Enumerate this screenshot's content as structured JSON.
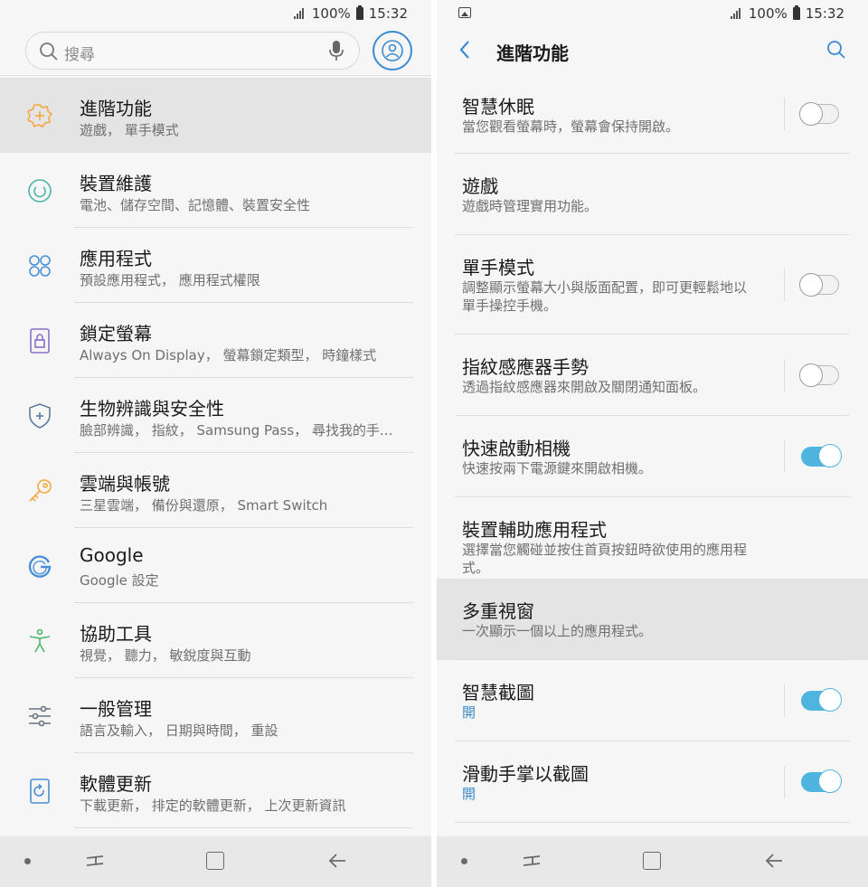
{
  "status": {
    "battery_pct": "100%",
    "time": "15:32"
  },
  "left": {
    "search_placeholder": "搜尋",
    "items": [
      {
        "title": "進階功能",
        "subtitle": "遊戲， 單手模式",
        "icon": "advanced-features-icon",
        "color": "#f5a742"
      },
      {
        "title": "裝置維護",
        "subtitle": "電池、儲存空間、記憶體、裝置安全性",
        "icon": "device-care-icon",
        "color": "#4ab6a5"
      },
      {
        "title": "應用程式",
        "subtitle": "預設應用程式， 應用程式權限",
        "icon": "apps-icon",
        "color": "#4a90d9"
      },
      {
        "title": "鎖定螢幕",
        "subtitle": "Always On Display， 螢幕鎖定類型， 時鐘樣式",
        "icon": "lock-screen-icon",
        "color": "#8b6fc9"
      },
      {
        "title": "生物辨識與安全性",
        "subtitle": "臉部辨識， 指紋， Samsung Pass， 尋找我的手...",
        "icon": "shield-icon",
        "color": "#5d7d99"
      },
      {
        "title": "雲端與帳號",
        "subtitle": "三星雲端， 備份與還原， Smart Switch",
        "icon": "key-icon",
        "color": "#f5a742"
      },
      {
        "title": "Google",
        "subtitle": "Google 設定",
        "icon": "google-icon",
        "color": "#4a90d9"
      },
      {
        "title": "協助工具",
        "subtitle": "視覺， 聽力， 敏銳度與互動",
        "icon": "accessibility-icon",
        "color": "#4cb86a"
      },
      {
        "title": "一般管理",
        "subtitle": "語言及輸入， 日期與時間， 重設",
        "icon": "sliders-icon",
        "color": "#6a7480"
      },
      {
        "title": "軟體更新",
        "subtitle": "下載更新， 排定的軟體更新， 上次更新資訊",
        "icon": "software-update-icon",
        "color": "#4a90d9"
      }
    ]
  },
  "right": {
    "title": "進階功能",
    "items": [
      {
        "title": "智慧休眠",
        "subtitle": "當您觀看螢幕時，螢幕會保持開啟。",
        "toggle": "off"
      },
      {
        "title": "遊戲",
        "subtitle": "遊戲時管理實用功能。",
        "toggle": null
      },
      {
        "title": "單手模式",
        "subtitle": "調整顯示螢幕大小與版面配置，即可更輕鬆地以單手操控手機。",
        "toggle": "off"
      },
      {
        "title": "指紋感應器手勢",
        "subtitle": "透過指紋感應器來開啟及關閉通知面板。",
        "toggle": "off"
      },
      {
        "title": "快速啟動相機",
        "subtitle": "快速按兩下電源鍵來開啟相機。",
        "toggle": "on"
      },
      {
        "title": "裝置輔助應用程式",
        "subtitle": "選擇當您觸碰並按住首頁按鈕時欲使用的應用程式。",
        "toggle": null
      },
      {
        "title": "多重視窗",
        "subtitle": "一次顯示一個以上的應用程式。",
        "toggle": null
      },
      {
        "title": "智慧截圖",
        "subtitle": "開",
        "toggle": "on",
        "subtitle_on": true
      },
      {
        "title": "滑動手掌以截圖",
        "subtitle": "開",
        "toggle": "on",
        "subtitle_on": true
      }
    ]
  },
  "colors": {
    "accent": "#3c8ad3",
    "toggle_on": "#4fb5df",
    "active_row": "#e4e4e4"
  }
}
